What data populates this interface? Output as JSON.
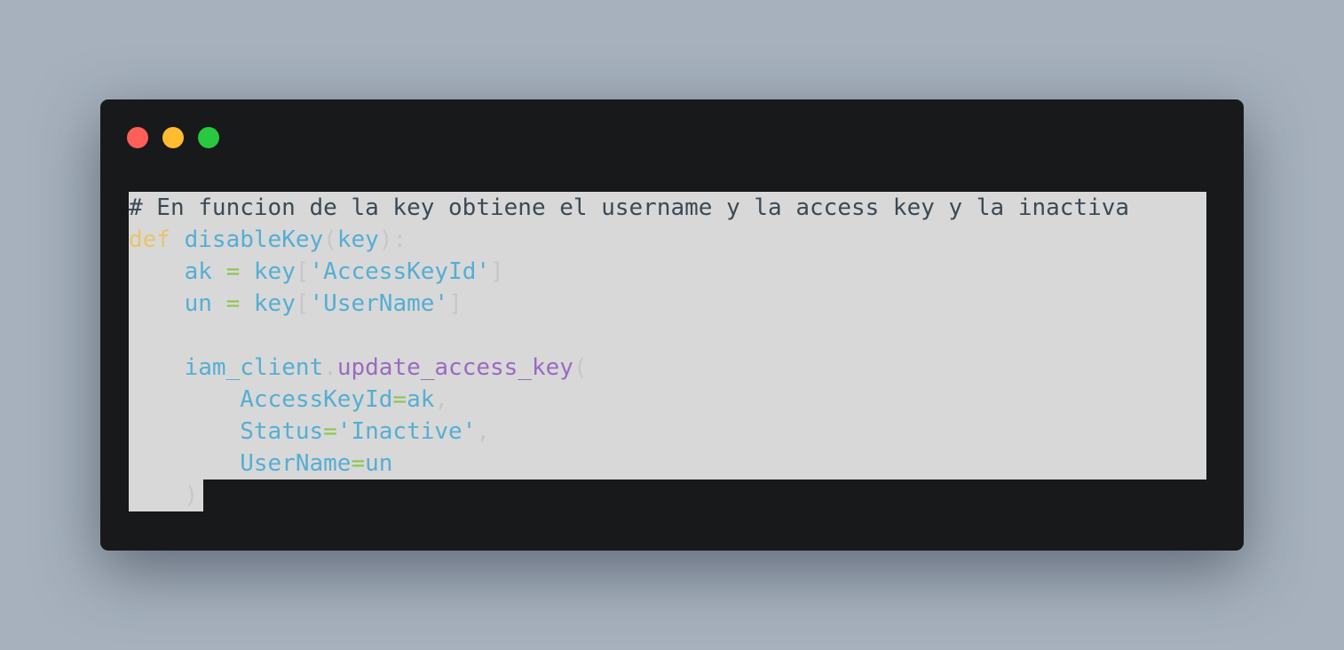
{
  "window": {
    "controls": [
      "close",
      "minimize",
      "maximize"
    ]
  },
  "code": {
    "language": "python",
    "lines": [
      {
        "tokens": [
          {
            "t": "# En funcion de la key obtiene el username y la access key y la inactiva",
            "k": "cm"
          }
        ]
      },
      {
        "tokens": [
          {
            "t": "def",
            "k": "kw"
          },
          {
            "t": " ",
            "k": "pn"
          },
          {
            "t": "disableKey",
            "k": "fn"
          },
          {
            "t": "(",
            "k": "pn"
          },
          {
            "t": "key",
            "k": "id"
          },
          {
            "t": "):",
            "k": "pn"
          }
        ]
      },
      {
        "tokens": [
          {
            "t": "    ",
            "k": "pn"
          },
          {
            "t": "ak",
            "k": "id"
          },
          {
            "t": " = ",
            "k": "op"
          },
          {
            "t": "key",
            "k": "id"
          },
          {
            "t": "[",
            "k": "pn"
          },
          {
            "t": "'AccessKeyId'",
            "k": "str"
          },
          {
            "t": "]",
            "k": "pn"
          }
        ]
      },
      {
        "tokens": [
          {
            "t": "    ",
            "k": "pn"
          },
          {
            "t": "un",
            "k": "id"
          },
          {
            "t": " = ",
            "k": "op"
          },
          {
            "t": "key",
            "k": "id"
          },
          {
            "t": "[",
            "k": "pn"
          },
          {
            "t": "'UserName'",
            "k": "str"
          },
          {
            "t": "]",
            "k": "pn"
          }
        ]
      },
      {
        "tokens": []
      },
      {
        "tokens": [
          {
            "t": "    ",
            "k": "pn"
          },
          {
            "t": "iam_client",
            "k": "id"
          },
          {
            "t": ".",
            "k": "pn"
          },
          {
            "t": "update_access_key",
            "k": "mt"
          },
          {
            "t": "(",
            "k": "pn"
          }
        ]
      },
      {
        "tokens": [
          {
            "t": "        ",
            "k": "pn"
          },
          {
            "t": "AccessKeyId",
            "k": "id"
          },
          {
            "t": "=",
            "k": "op"
          },
          {
            "t": "ak",
            "k": "id"
          },
          {
            "t": ",",
            "k": "pn"
          }
        ]
      },
      {
        "tokens": [
          {
            "t": "        ",
            "k": "pn"
          },
          {
            "t": "Status",
            "k": "id"
          },
          {
            "t": "=",
            "k": "op"
          },
          {
            "t": "'Inactive'",
            "k": "str"
          },
          {
            "t": ",",
            "k": "pn"
          }
        ]
      },
      {
        "tokens": [
          {
            "t": "        ",
            "k": "pn"
          },
          {
            "t": "UserName",
            "k": "id"
          },
          {
            "t": "=",
            "k": "op"
          },
          {
            "t": "un",
            "k": "id"
          }
        ]
      },
      {
        "tokens": [
          {
            "t": "    ",
            "k": "pn"
          },
          {
            "t": ")",
            "k": "pn"
          }
        ]
      }
    ]
  },
  "colors": {
    "background": "#a6b1bd",
    "window": "#17191b",
    "selection": "#d8d8d8",
    "close": "#fe5f57",
    "minimize": "#febc2e",
    "maximize": "#28c840"
  }
}
